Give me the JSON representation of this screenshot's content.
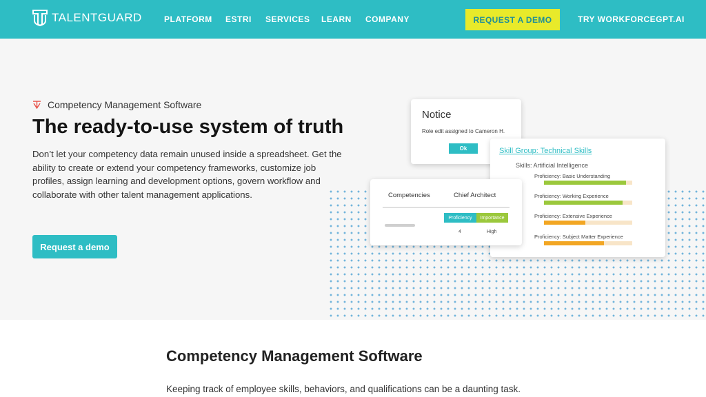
{
  "header": {
    "logo_text": "TALENTGUARD",
    "nav": [
      "PLATFORM",
      "ESTRI",
      "SERVICES",
      "LEARN",
      "COMPANY"
    ],
    "cta_label": "REQUEST A DEMO",
    "try_label": "TRY WORKFORCEGPT.AI"
  },
  "hero": {
    "eyebrow": "Competency Management Software",
    "title": "The ready-to-use system of truth",
    "description": "Don’t let your competency data remain unused inside a spreadsheet. Get the ability to create or extend your competency frameworks, customize job profiles, assign learning and development options, govern workflow and collaborate with other talent management applications.",
    "button_label": "Request a demo"
  },
  "notice_card": {
    "title": "Notice",
    "message": "Role edit assigned to Cameron H.",
    "ok_label": "Ok"
  },
  "skills_card": {
    "title": "Skill Group: Technical Skills",
    "subtitle": "Skills: Artificial Intelligence",
    "items": [
      {
        "label": "Proficiency: Basic Understanding",
        "level": 0.93,
        "color": "#9bc83c"
      },
      {
        "label": "Proficiency: Working Experience",
        "level": 0.89,
        "color": "#9bc83c"
      },
      {
        "label": "Proficiency: Extensive Experience",
        "level": 0.47,
        "color": "#f2a623"
      },
      {
        "label": "Proficiency: Subject Matter Experience",
        "level": 0.68,
        "color": "#f2a623"
      }
    ]
  },
  "competency_card": {
    "col1": "Competencies",
    "col2": "Chief Architect",
    "tag1": "Proficiency",
    "tag2": "Importance",
    "value1": "4",
    "value2": "High",
    "tag1_color": "#2ebdc4",
    "tag2_color": "#9bc83c"
  },
  "section": {
    "title": "Competency Management Software",
    "text": "Keeping track of employee skills, behaviors, and qualifications can be a daunting task."
  },
  "colors": {
    "brand": "#2ebdc4",
    "cta": "#e8ea2a"
  }
}
